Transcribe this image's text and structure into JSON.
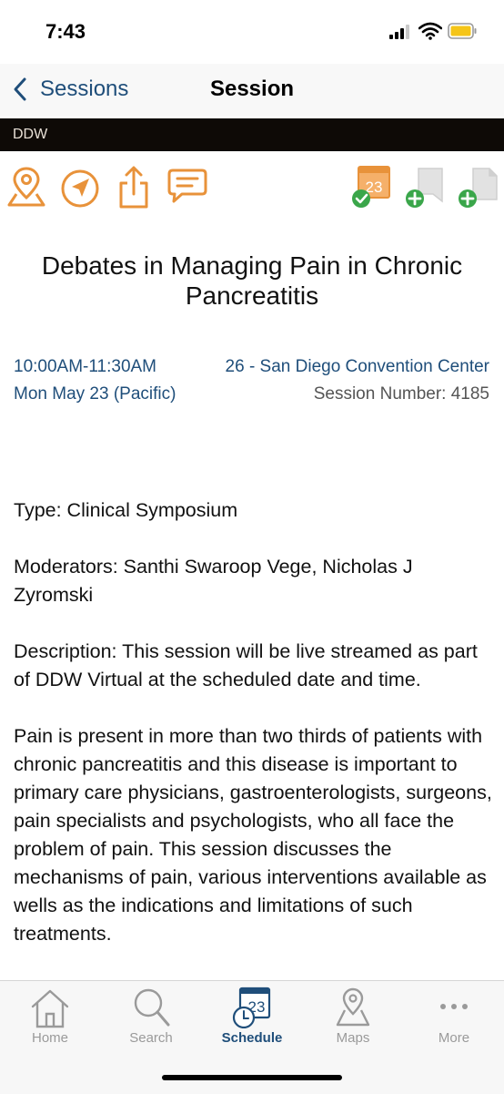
{
  "status": {
    "time": "7:43"
  },
  "nav": {
    "back_label": "Sessions",
    "title": "Session"
  },
  "banner": {
    "org": "DDW"
  },
  "toolbar": {
    "icons": [
      "map-pin-icon",
      "navigate-icon",
      "share-icon",
      "comment-icon",
      "calendar-added-icon",
      "add-note-icon",
      "add-document-icon"
    ],
    "calendar_day": "23"
  },
  "session": {
    "title": "Debates in Managing Pain in Chronic Pancreatitis",
    "time": "10:00AM-11:30AM",
    "date": "Mon May 23 (Pacific)",
    "location": "26 - San Diego Convention Center",
    "number": "Session Number: 4185",
    "type": "Type: Clinical Symposium",
    "moderators": "Moderators: Santhi Swaroop Vege, Nicholas J Zyromski",
    "description": "Description: This session will be live streamed as part of DDW Virtual at the scheduled date and time.",
    "body": "Pain is present in more than two thirds of patients with chronic pancreatitis and this disease is important to primary care physicians, gastroenterologists, surgeons, pain specialists and psychologists, who all face the problem of pain. This session discusses the mechanisms of pain, various interventions available as wells as the indications and limitations of such treatments."
  },
  "tabs": [
    {
      "label": "Home",
      "icon": "home-icon"
    },
    {
      "label": "Search",
      "icon": "search-icon"
    },
    {
      "label": "Schedule",
      "icon": "schedule-icon",
      "day": "23",
      "active": true
    },
    {
      "label": "Maps",
      "icon": "map-icon"
    },
    {
      "label": "More",
      "icon": "more-icon"
    }
  ],
  "colors": {
    "accent": "#1f4e7a",
    "toolbar_orange": "#e8923a",
    "add_green": "#3aa64a"
  }
}
